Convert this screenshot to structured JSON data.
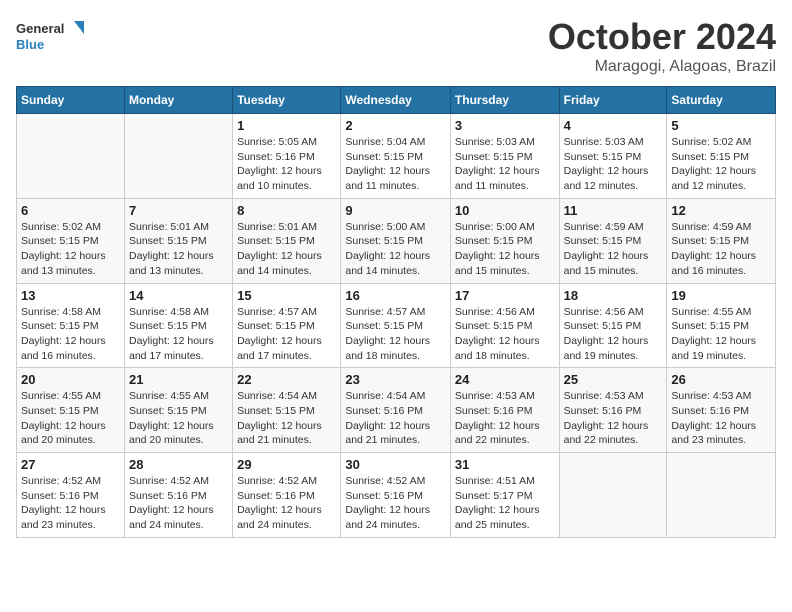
{
  "logo": {
    "general": "General",
    "blue": "Blue"
  },
  "header": {
    "month": "October 2024",
    "location": "Maragogi, Alagoas, Brazil"
  },
  "weekdays": [
    "Sunday",
    "Monday",
    "Tuesday",
    "Wednesday",
    "Thursday",
    "Friday",
    "Saturday"
  ],
  "weeks": [
    [
      {
        "day": null
      },
      {
        "day": null
      },
      {
        "day": "1",
        "sunrise": "Sunrise: 5:05 AM",
        "sunset": "Sunset: 5:16 PM",
        "daylight": "Daylight: 12 hours and 10 minutes."
      },
      {
        "day": "2",
        "sunrise": "Sunrise: 5:04 AM",
        "sunset": "Sunset: 5:15 PM",
        "daylight": "Daylight: 12 hours and 11 minutes."
      },
      {
        "day": "3",
        "sunrise": "Sunrise: 5:03 AM",
        "sunset": "Sunset: 5:15 PM",
        "daylight": "Daylight: 12 hours and 11 minutes."
      },
      {
        "day": "4",
        "sunrise": "Sunrise: 5:03 AM",
        "sunset": "Sunset: 5:15 PM",
        "daylight": "Daylight: 12 hours and 12 minutes."
      },
      {
        "day": "5",
        "sunrise": "Sunrise: 5:02 AM",
        "sunset": "Sunset: 5:15 PM",
        "daylight": "Daylight: 12 hours and 12 minutes."
      }
    ],
    [
      {
        "day": "6",
        "sunrise": "Sunrise: 5:02 AM",
        "sunset": "Sunset: 5:15 PM",
        "daylight": "Daylight: 12 hours and 13 minutes."
      },
      {
        "day": "7",
        "sunrise": "Sunrise: 5:01 AM",
        "sunset": "Sunset: 5:15 PM",
        "daylight": "Daylight: 12 hours and 13 minutes."
      },
      {
        "day": "8",
        "sunrise": "Sunrise: 5:01 AM",
        "sunset": "Sunset: 5:15 PM",
        "daylight": "Daylight: 12 hours and 14 minutes."
      },
      {
        "day": "9",
        "sunrise": "Sunrise: 5:00 AM",
        "sunset": "Sunset: 5:15 PM",
        "daylight": "Daylight: 12 hours and 14 minutes."
      },
      {
        "day": "10",
        "sunrise": "Sunrise: 5:00 AM",
        "sunset": "Sunset: 5:15 PM",
        "daylight": "Daylight: 12 hours and 15 minutes."
      },
      {
        "day": "11",
        "sunrise": "Sunrise: 4:59 AM",
        "sunset": "Sunset: 5:15 PM",
        "daylight": "Daylight: 12 hours and 15 minutes."
      },
      {
        "day": "12",
        "sunrise": "Sunrise: 4:59 AM",
        "sunset": "Sunset: 5:15 PM",
        "daylight": "Daylight: 12 hours and 16 minutes."
      }
    ],
    [
      {
        "day": "13",
        "sunrise": "Sunrise: 4:58 AM",
        "sunset": "Sunset: 5:15 PM",
        "daylight": "Daylight: 12 hours and 16 minutes."
      },
      {
        "day": "14",
        "sunrise": "Sunrise: 4:58 AM",
        "sunset": "Sunset: 5:15 PM",
        "daylight": "Daylight: 12 hours and 17 minutes."
      },
      {
        "day": "15",
        "sunrise": "Sunrise: 4:57 AM",
        "sunset": "Sunset: 5:15 PM",
        "daylight": "Daylight: 12 hours and 17 minutes."
      },
      {
        "day": "16",
        "sunrise": "Sunrise: 4:57 AM",
        "sunset": "Sunset: 5:15 PM",
        "daylight": "Daylight: 12 hours and 18 minutes."
      },
      {
        "day": "17",
        "sunrise": "Sunrise: 4:56 AM",
        "sunset": "Sunset: 5:15 PM",
        "daylight": "Daylight: 12 hours and 18 minutes."
      },
      {
        "day": "18",
        "sunrise": "Sunrise: 4:56 AM",
        "sunset": "Sunset: 5:15 PM",
        "daylight": "Daylight: 12 hours and 19 minutes."
      },
      {
        "day": "19",
        "sunrise": "Sunrise: 4:55 AM",
        "sunset": "Sunset: 5:15 PM",
        "daylight": "Daylight: 12 hours and 19 minutes."
      }
    ],
    [
      {
        "day": "20",
        "sunrise": "Sunrise: 4:55 AM",
        "sunset": "Sunset: 5:15 PM",
        "daylight": "Daylight: 12 hours and 20 minutes."
      },
      {
        "day": "21",
        "sunrise": "Sunrise: 4:55 AM",
        "sunset": "Sunset: 5:15 PM",
        "daylight": "Daylight: 12 hours and 20 minutes."
      },
      {
        "day": "22",
        "sunrise": "Sunrise: 4:54 AM",
        "sunset": "Sunset: 5:15 PM",
        "daylight": "Daylight: 12 hours and 21 minutes."
      },
      {
        "day": "23",
        "sunrise": "Sunrise: 4:54 AM",
        "sunset": "Sunset: 5:16 PM",
        "daylight": "Daylight: 12 hours and 21 minutes."
      },
      {
        "day": "24",
        "sunrise": "Sunrise: 4:53 AM",
        "sunset": "Sunset: 5:16 PM",
        "daylight": "Daylight: 12 hours and 22 minutes."
      },
      {
        "day": "25",
        "sunrise": "Sunrise: 4:53 AM",
        "sunset": "Sunset: 5:16 PM",
        "daylight": "Daylight: 12 hours and 22 minutes."
      },
      {
        "day": "26",
        "sunrise": "Sunrise: 4:53 AM",
        "sunset": "Sunset: 5:16 PM",
        "daylight": "Daylight: 12 hours and 23 minutes."
      }
    ],
    [
      {
        "day": "27",
        "sunrise": "Sunrise: 4:52 AM",
        "sunset": "Sunset: 5:16 PM",
        "daylight": "Daylight: 12 hours and 23 minutes."
      },
      {
        "day": "28",
        "sunrise": "Sunrise: 4:52 AM",
        "sunset": "Sunset: 5:16 PM",
        "daylight": "Daylight: 12 hours and 24 minutes."
      },
      {
        "day": "29",
        "sunrise": "Sunrise: 4:52 AM",
        "sunset": "Sunset: 5:16 PM",
        "daylight": "Daylight: 12 hours and 24 minutes."
      },
      {
        "day": "30",
        "sunrise": "Sunrise: 4:52 AM",
        "sunset": "Sunset: 5:16 PM",
        "daylight": "Daylight: 12 hours and 24 minutes."
      },
      {
        "day": "31",
        "sunrise": "Sunrise: 4:51 AM",
        "sunset": "Sunset: 5:17 PM",
        "daylight": "Daylight: 12 hours and 25 minutes."
      },
      {
        "day": null
      },
      {
        "day": null
      }
    ]
  ]
}
